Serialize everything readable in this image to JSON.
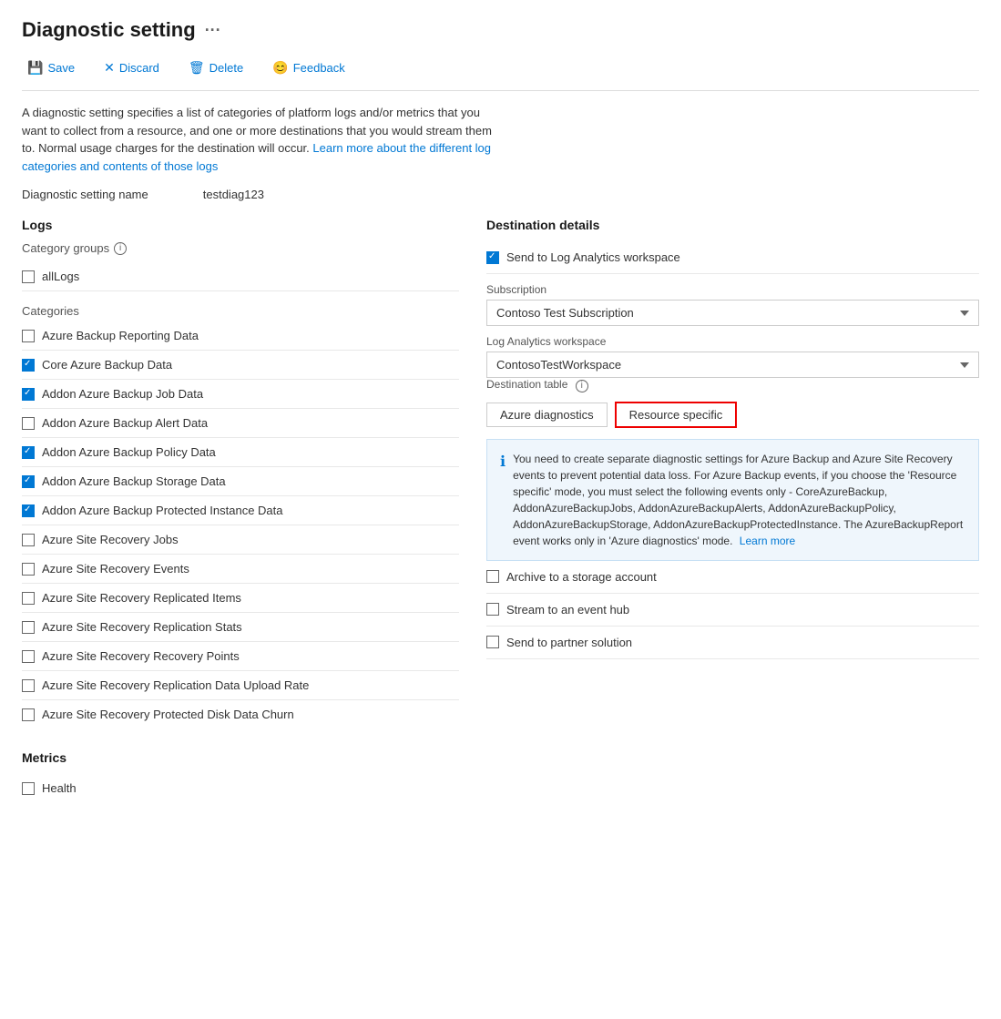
{
  "page": {
    "title": "Diagnostic setting",
    "ellipsis": "···"
  },
  "toolbar": {
    "save": "Save",
    "discard": "Discard",
    "delete": "Delete",
    "feedback": "Feedback"
  },
  "description": {
    "text": "A diagnostic setting specifies a list of categories of platform logs and/or metrics that you want to collect from a resource, and one or more destinations that you would stream them to. Normal usage charges for the destination will occur.",
    "link_text": "Learn more about the different log categories and contents of those logs"
  },
  "diagnostic_setting_name": {
    "label": "Diagnostic setting name",
    "value": "testdiag123"
  },
  "logs": {
    "section_title": "Logs",
    "category_groups_label": "Category groups",
    "all_logs_label": "allLogs",
    "categories_label": "Categories",
    "categories": [
      {
        "id": "cat1",
        "label": "Azure Backup Reporting Data",
        "checked": false
      },
      {
        "id": "cat2",
        "label": "Core Azure Backup Data",
        "checked": true
      },
      {
        "id": "cat3",
        "label": "Addon Azure Backup Job Data",
        "checked": true
      },
      {
        "id": "cat4",
        "label": "Addon Azure Backup Alert Data",
        "checked": false
      },
      {
        "id": "cat5",
        "label": "Addon Azure Backup Policy Data",
        "checked": true
      },
      {
        "id": "cat6",
        "label": "Addon Azure Backup Storage Data",
        "checked": true
      },
      {
        "id": "cat7",
        "label": "Addon Azure Backup Protected Instance Data",
        "checked": true
      },
      {
        "id": "cat8",
        "label": "Azure Site Recovery Jobs",
        "checked": false
      },
      {
        "id": "cat9",
        "label": "Azure Site Recovery Events",
        "checked": false
      },
      {
        "id": "cat10",
        "label": "Azure Site Recovery Replicated Items",
        "checked": false
      },
      {
        "id": "cat11",
        "label": "Azure Site Recovery Replication Stats",
        "checked": false
      },
      {
        "id": "cat12",
        "label": "Azure Site Recovery Recovery Points",
        "checked": false
      },
      {
        "id": "cat13",
        "label": "Azure Site Recovery Replication Data Upload Rate",
        "checked": false
      },
      {
        "id": "cat14",
        "label": "Azure Site Recovery Protected Disk Data Churn",
        "checked": false
      }
    ]
  },
  "metrics": {
    "section_title": "Metrics",
    "items": [
      {
        "id": "m1",
        "label": "Health",
        "checked": false
      }
    ]
  },
  "destination": {
    "section_title": "Destination details",
    "send_to_log_analytics": {
      "label": "Send to Log Analytics workspace",
      "checked": true
    },
    "subscription": {
      "label": "Subscription",
      "value": "Contoso Test Subscription"
    },
    "log_analytics_workspace": {
      "label": "Log Analytics workspace",
      "value": "ContosoTestWorkspace"
    },
    "destination_table": {
      "label": "Destination table",
      "azure_diagnostics_label": "Azure diagnostics",
      "resource_specific_label": "Resource specific"
    },
    "info_box": {
      "text": "You need to create separate diagnostic settings for Azure Backup and Azure Site Recovery events to prevent potential data loss. For Azure Backup events, if you choose the 'Resource specific' mode, you must select the following events only - CoreAzureBackup, AddonAzureBackupJobs, AddonAzureBackupAlerts, AddonAzureBackupPolicy, AddonAzureBackupStorage, AddonAzureBackupProtectedInstance. The AzureBackupReport event works only in 'Azure diagnostics' mode.",
      "link_text": "Learn more"
    },
    "archive_to_storage": {
      "label": "Archive to a storage account",
      "checked": false
    },
    "stream_to_event_hub": {
      "label": "Stream to an event hub",
      "checked": false
    },
    "send_to_partner": {
      "label": "Send to partner solution",
      "checked": false
    }
  }
}
